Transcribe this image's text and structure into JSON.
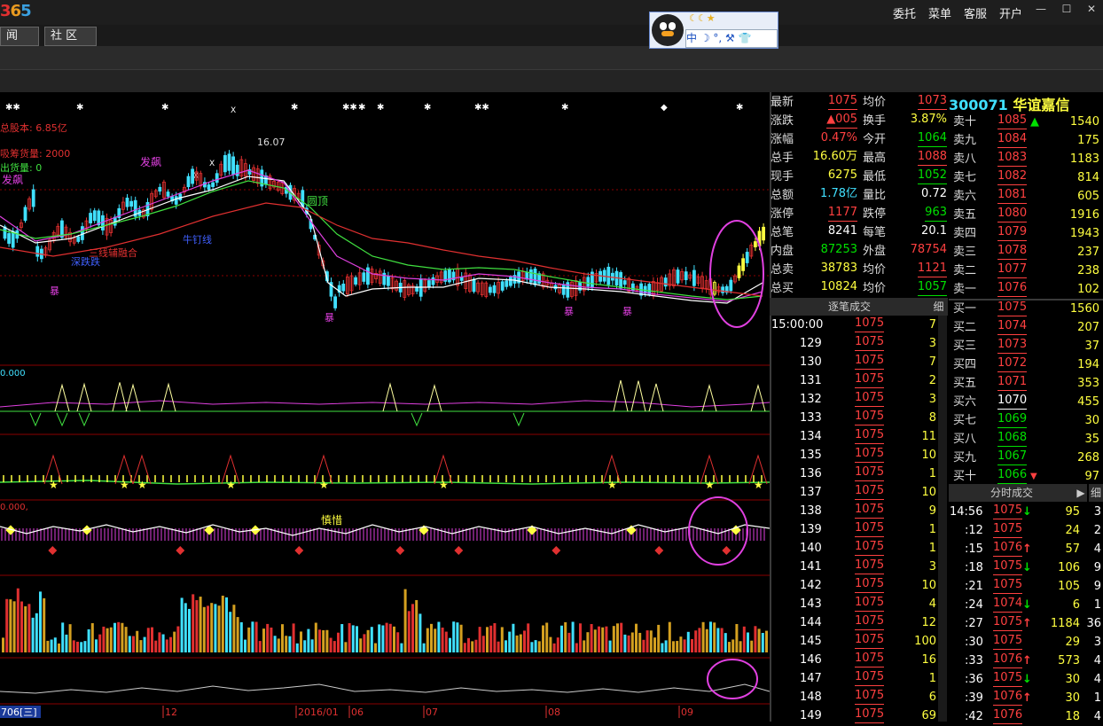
{
  "app": {
    "logo": [
      "3",
      "6",
      "5"
    ],
    "menu": [
      "委托",
      "菜单",
      "客服",
      "开户"
    ],
    "tabs": [
      "闻",
      "社 区"
    ],
    "qq_stars": "☾☾★",
    "qq_bar": "中 ☽ °, ⚒ 👕"
  },
  "chart_text": {
    "share_cap": "总股本: 6.85亿",
    "cost_vol": "吸筹货量: 2000",
    "dist_vol": "出货量: 0",
    "peak_price": "16.07",
    "label_fa": "发飙",
    "label_fa2": "发飙",
    "label_round": "圆顶",
    "label_deep": "深跌跌",
    "label_three": "三线辅融合",
    "label_bull": "牛钉线",
    "label_bao": [
      "暴",
      "暴",
      "暴",
      "暴"
    ],
    "sub1_val": "0.000",
    "sub3_val": "0.000,",
    "sub3_label": "慎惜",
    "date_start": "706[三]",
    "dates": [
      "12",
      "2016/01",
      "06",
      "07",
      "08",
      "09"
    ]
  },
  "quote": {
    "rows": [
      {
        "l1": "最新",
        "v1": "1075",
        "c1": "red",
        "u1": true,
        "l2": "均价",
        "v2": "1073",
        "c2": "red",
        "u2": true
      },
      {
        "l1": "涨跌",
        "v1": "▲005",
        "c1": "red",
        "u1": true,
        "l2": "换手",
        "v2": "3.87%",
        "c2": "yellow",
        "u2": false
      },
      {
        "l1": "涨幅",
        "v1": "0.47%",
        "c1": "red",
        "u1": false,
        "l2": "今开",
        "v2": "1064",
        "c2": "green",
        "u2": true
      },
      {
        "l1": "总手",
        "v1": "16.60万",
        "c1": "yellow",
        "u1": false,
        "l2": "最高",
        "v2": "1088",
        "c2": "red",
        "u2": true
      },
      {
        "l1": "现手",
        "v1": "6275",
        "c1": "yellow",
        "u1": false,
        "l2": "最低",
        "v2": "1052",
        "c2": "green",
        "u2": true
      },
      {
        "l1": "总额",
        "v1": "1.78亿",
        "c1": "cyan",
        "u1": false,
        "l2": "量比",
        "v2": "0.72",
        "c2": "white",
        "u2": false
      },
      {
        "l1": "涨停",
        "v1": "1177",
        "c1": "red",
        "u1": true,
        "l2": "跌停",
        "v2": "963",
        "c2": "green",
        "u2": true
      },
      {
        "l1": "总笔",
        "v1": "8241",
        "c1": "white",
        "u1": false,
        "l2": "每笔",
        "v2": "20.1",
        "c2": "white",
        "u2": false
      },
      {
        "l1": "内盘",
        "v1": "87253",
        "c1": "green",
        "u1": false,
        "l2": "外盘",
        "v2": "78754",
        "c2": "red",
        "u2": false
      },
      {
        "l1": "总卖",
        "v1": "38783",
        "c1": "yellow",
        "u1": false,
        "l2": "均价",
        "v2": "1121",
        "c2": "red",
        "u2": true
      },
      {
        "l1": "总买",
        "v1": "10824",
        "c1": "yellow",
        "u1": false,
        "l2": "均价",
        "v2": "1057",
        "c2": "green",
        "u2": true
      }
    ]
  },
  "book": {
    "code": "300071",
    "name": "华谊嘉信",
    "asks": [
      {
        "l": "卖十",
        "p": "1085",
        "v": "1540",
        "arrow": "▲"
      },
      {
        "l": "卖九",
        "p": "1084",
        "v": "175",
        "arrow": ""
      },
      {
        "l": "卖八",
        "p": "1083",
        "v": "1183",
        "arrow": ""
      },
      {
        "l": "卖七",
        "p": "1082",
        "v": "814",
        "arrow": ""
      },
      {
        "l": "卖六",
        "p": "1081",
        "v": "605",
        "arrow": ""
      },
      {
        "l": "卖五",
        "p": "1080",
        "v": "1916",
        "arrow": ""
      },
      {
        "l": "卖四",
        "p": "1079",
        "v": "1943",
        "arrow": ""
      },
      {
        "l": "卖三",
        "p": "1078",
        "v": "237",
        "arrow": ""
      },
      {
        "l": "卖二",
        "p": "1077",
        "v": "238",
        "arrow": ""
      },
      {
        "l": "卖一",
        "p": "1076",
        "v": "102",
        "arrow": ""
      }
    ],
    "bids": [
      {
        "l": "买一",
        "p": "1075",
        "v": "1560",
        "pc": "red",
        "arrow": ""
      },
      {
        "l": "买二",
        "p": "1074",
        "v": "207",
        "pc": "red",
        "arrow": ""
      },
      {
        "l": "买三",
        "p": "1073",
        "v": "37",
        "pc": "red",
        "arrow": ""
      },
      {
        "l": "买四",
        "p": "1072",
        "v": "194",
        "pc": "red",
        "arrow": ""
      },
      {
        "l": "买五",
        "p": "1071",
        "v": "353",
        "pc": "red",
        "arrow": ""
      },
      {
        "l": "买六",
        "p": "1070",
        "v": "455",
        "pc": "white",
        "arrow": ""
      },
      {
        "l": "买七",
        "p": "1069",
        "v": "30",
        "pc": "green",
        "arrow": ""
      },
      {
        "l": "买八",
        "p": "1068",
        "v": "35",
        "pc": "green",
        "arrow": ""
      },
      {
        "l": "买九",
        "p": "1067",
        "v": "268",
        "pc": "green",
        "arrow": ""
      },
      {
        "l": "买十",
        "p": "1066",
        "v": "97",
        "pc": "green",
        "arrow": "▼"
      }
    ]
  },
  "ticks": {
    "header": "逐笔成交",
    "detail_btn": "细",
    "rows": [
      {
        "t": "15:00:00",
        "p": "1075",
        "v": "7"
      },
      {
        "t": "129",
        "p": "1075",
        "v": "3"
      },
      {
        "t": "130",
        "p": "1075",
        "v": "7"
      },
      {
        "t": "131",
        "p": "1075",
        "v": "2"
      },
      {
        "t": "132",
        "p": "1075",
        "v": "3"
      },
      {
        "t": "133",
        "p": "1075",
        "v": "8"
      },
      {
        "t": "134",
        "p": "1075",
        "v": "11"
      },
      {
        "t": "135",
        "p": "1075",
        "v": "10"
      },
      {
        "t": "136",
        "p": "1075",
        "v": "1"
      },
      {
        "t": "137",
        "p": "1075",
        "v": "10"
      },
      {
        "t": "138",
        "p": "1075",
        "v": "9"
      },
      {
        "t": "139",
        "p": "1075",
        "v": "1"
      },
      {
        "t": "140",
        "p": "1075",
        "v": "1"
      },
      {
        "t": "141",
        "p": "1075",
        "v": "3"
      },
      {
        "t": "142",
        "p": "1075",
        "v": "10"
      },
      {
        "t": "143",
        "p": "1075",
        "v": "4"
      },
      {
        "t": "144",
        "p": "1075",
        "v": "12"
      },
      {
        "t": "145",
        "p": "1075",
        "v": "100"
      },
      {
        "t": "146",
        "p": "1075",
        "v": "16"
      },
      {
        "t": "147",
        "p": "1075",
        "v": "1"
      },
      {
        "t": "148",
        "p": "1075",
        "v": "6"
      },
      {
        "t": "149",
        "p": "1075",
        "v": "69"
      }
    ]
  },
  "minutes": {
    "header": "分时成交",
    "detail_btn": "细",
    "rows": [
      {
        "t": "14:56",
        "p": "1075",
        "a": "↓",
        "ac": "green",
        "v": "95",
        "n": "3"
      },
      {
        "t": ":12",
        "p": "1075",
        "a": "",
        "ac": "",
        "v": "24",
        "n": "2"
      },
      {
        "t": ":15",
        "p": "1076",
        "a": "↑",
        "ac": "red",
        "v": "57",
        "n": "4"
      },
      {
        "t": ":18",
        "p": "1075",
        "a": "↓",
        "ac": "green",
        "v": "106",
        "n": "9"
      },
      {
        "t": ":21",
        "p": "1075",
        "a": "",
        "ac": "",
        "v": "105",
        "n": "9"
      },
      {
        "t": ":24",
        "p": "1074",
        "a": "↓",
        "ac": "green",
        "v": "6",
        "n": "1"
      },
      {
        "t": ":27",
        "p": "1075",
        "a": "↑",
        "ac": "red",
        "v": "1184",
        "n": "36"
      },
      {
        "t": ":30",
        "p": "1075",
        "a": "",
        "ac": "",
        "v": "29",
        "n": "3"
      },
      {
        "t": ":33",
        "p": "1076",
        "a": "↑",
        "ac": "red",
        "v": "573",
        "n": "4"
      },
      {
        "t": ":36",
        "p": "1075",
        "a": "↓",
        "ac": "green",
        "v": "30",
        "n": "4"
      },
      {
        "t": ":39",
        "p": "1076",
        "a": "↑",
        "ac": "red",
        "v": "30",
        "n": "1"
      },
      {
        "t": ":42",
        "p": "1076",
        "a": "",
        "ac": "",
        "v": "18",
        "n": "4"
      }
    ]
  }
}
